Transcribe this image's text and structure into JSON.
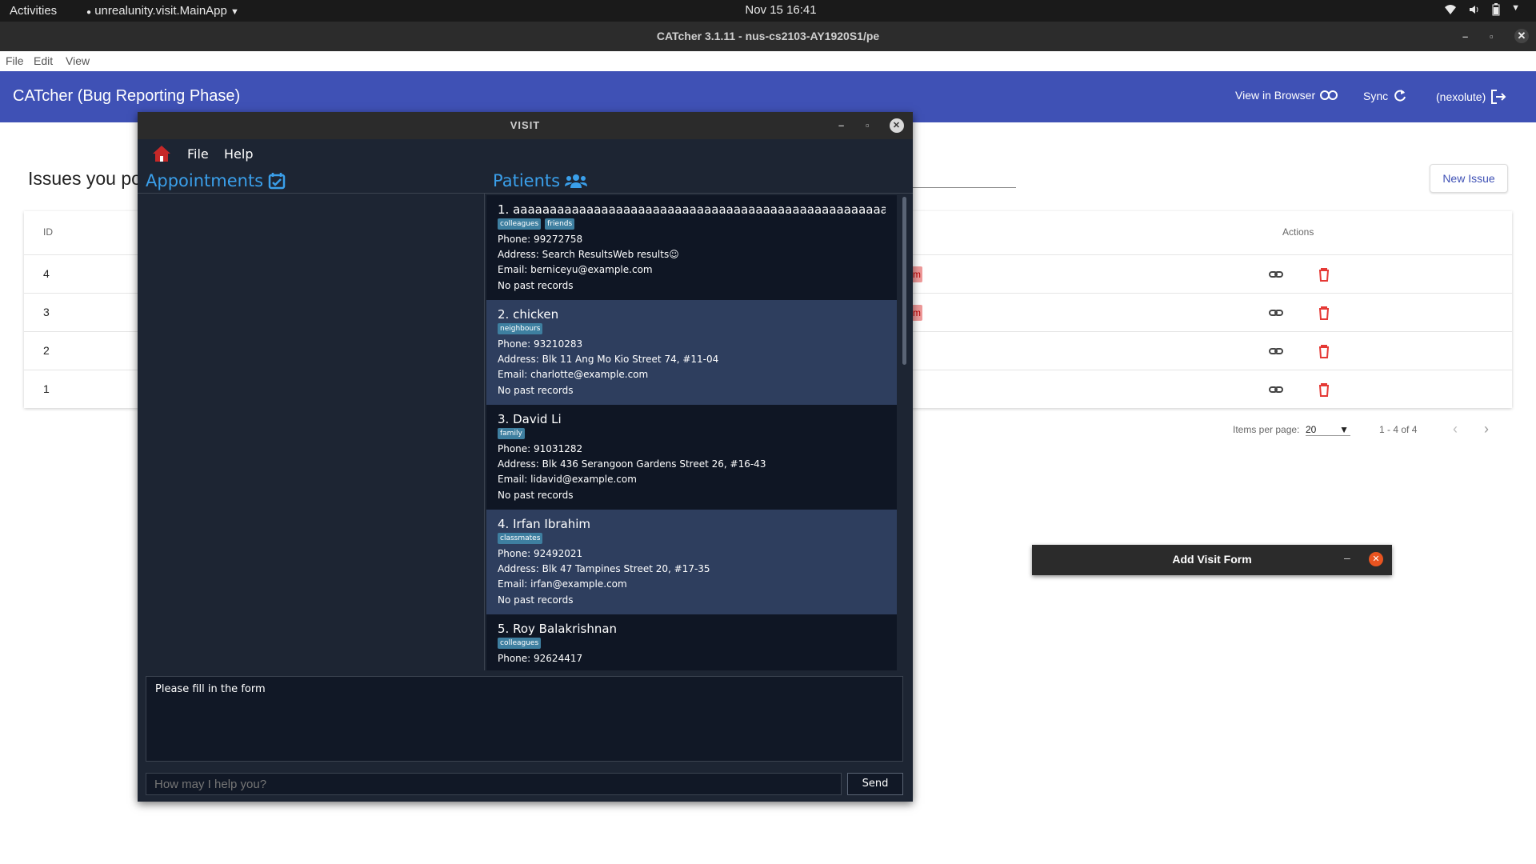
{
  "topbar": {
    "activities": "Activities",
    "app": "unrealunity.visit.MainApp",
    "clock": "Nov 15  16:41"
  },
  "window": {
    "title": "CATcher 3.1.11 - nus-cs2103-AY1920S1/pe"
  },
  "menubar": {
    "file": "File",
    "edit": "Edit",
    "view": "View"
  },
  "header": {
    "title": "CATcher  (Bug Reporting Phase)",
    "view_in_browser": "View in Browser",
    "sync": "Sync",
    "user": "(nexolute)"
  },
  "issues": {
    "title": "Issues you po",
    "new_issue": "New Issue",
    "col_id": "ID",
    "col_actions": "Actions",
    "rows": [
      {
        "id": "4",
        "label": "m"
      },
      {
        "id": "3",
        "label": "m"
      },
      {
        "id": "2",
        "label": ""
      },
      {
        "id": "1",
        "label": ""
      }
    ],
    "items_per_page_label": "Items per page:",
    "items_per_page": "20",
    "range": "1 - 4 of 4"
  },
  "add_visit_form": {
    "title": "Add Visit Form"
  },
  "visit": {
    "title": "VISIT",
    "menu": {
      "file": "File",
      "help": "Help"
    },
    "appointments_header": "Appointments",
    "patients_header": "Patients",
    "patients": [
      {
        "name": "1.  aaaaaaaaaaaaaaaaaaaaaaaaaaaaaaaaaaaaaaaaaaaaaaaaaaaaaaaaaaaaaaaa...",
        "tags": [
          "colleagues",
          "friends"
        ],
        "phone": "Phone: 99272758",
        "address": "Address: Search ResultsWeb results☺",
        "email": "Email: berniceyu@example.com",
        "records": "No past records"
      },
      {
        "name": "2.  chicken",
        "tags": [
          "neighbours"
        ],
        "phone": "Phone: 93210283",
        "address": "Address: Blk 11 Ang Mo Kio Street 74, #11-04",
        "email": "Email: charlotte@example.com",
        "records": "No past records"
      },
      {
        "name": "3.  David Li",
        "tags": [
          "family"
        ],
        "phone": "Phone: 91031282",
        "address": "Address: Blk 436 Serangoon Gardens Street 26, #16-43",
        "email": "Email: lidavid@example.com",
        "records": "No past records"
      },
      {
        "name": "4.  Irfan Ibrahim",
        "tags": [
          "classmates"
        ],
        "phone": "Phone: 92492021",
        "address": "Address: Blk 47 Tampines Street 20, #17-35",
        "email": "Email: irfan@example.com",
        "records": "No past records"
      },
      {
        "name": "5.  Roy Balakrishnan",
        "tags": [
          "colleagues"
        ],
        "phone": "Phone: 92624417",
        "address": "",
        "email": "",
        "records": ""
      }
    ],
    "result_text": "Please fill in the form",
    "command_placeholder": "How may I help you?",
    "send": "Send"
  }
}
